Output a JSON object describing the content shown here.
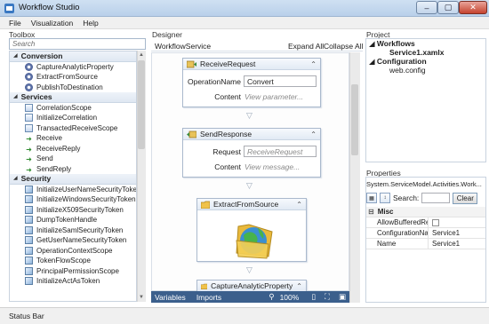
{
  "window": {
    "title": "Workflow Studio",
    "controls": {
      "minimize": "–",
      "maximize": "▢",
      "close": "✕"
    }
  },
  "menu": [
    "File",
    "Visualization",
    "Help"
  ],
  "toolbox": {
    "title": "Toolbox",
    "search_placeholder": "Search",
    "categories": [
      {
        "name": "Conversion",
        "items": [
          "CaptureAnalyticProperty",
          "ExtractFromSource",
          "PublishToDestination"
        ]
      },
      {
        "name": "Services",
        "items": [
          "CorrelationScope",
          "InitializeCorrelation",
          "TransactedReceiveScope",
          "Receive",
          "ReceiveReply",
          "Send",
          "SendReply"
        ]
      },
      {
        "name": "Security",
        "items": [
          "InitializeUserNameSecurityToken",
          "InitializeWindowsSecurityToken",
          "InitializeX509SecurityToken",
          "DumpTokenHandle",
          "InitializeSamlSecurityToken",
          "GetUserNameSecurityToken",
          "OperationContextScope",
          "TokenFlowScope",
          "PrincipalPermissionScope",
          "InitializeActAsToken"
        ]
      }
    ]
  },
  "designer": {
    "title": "Designer",
    "workflow_name": "WorkflowService",
    "expand_all": "Expand All",
    "collapse_all": "Collapse All",
    "activities": {
      "receive": {
        "title": "ReceiveRequest",
        "op_label": "OperationName",
        "op_value": "Convert",
        "content_label": "Content",
        "content_placeholder": "View parameter..."
      },
      "send": {
        "title": "SendResponse",
        "request_label": "Request",
        "request_placeholder": "ReceiveRequest",
        "content_label": "Content",
        "content_placeholder": "View message..."
      },
      "extract": {
        "title": "ExtractFromSource"
      },
      "capture": {
        "title": "CaptureAnalyticProperty"
      }
    },
    "bottombar": {
      "variables": "Variables",
      "imports": "Imports",
      "zoom": "100%"
    }
  },
  "project": {
    "title": "Project",
    "tree": [
      {
        "label": "Workflows",
        "bold": true,
        "children": [
          "Service1.xamlx"
        ]
      },
      {
        "label": "Configuration",
        "bold": true,
        "children": [
          "web.config"
        ]
      }
    ]
  },
  "properties": {
    "title": "Properties",
    "type_name": "System.ServiceModel.Activities.Work...",
    "search_label": "Search:",
    "clear_label": "Clear",
    "category": "Misc",
    "rows": [
      {
        "key": "AllowBufferedRec...",
        "value": ""
      },
      {
        "key": "ConfigurationName",
        "value": "Service1"
      },
      {
        "key": "Name",
        "value": "Service1"
      }
    ]
  },
  "statusbar": {
    "text": "Status Bar"
  },
  "colors": {
    "accent": "#3b5f8c",
    "titlebar": "#c3d7ee"
  }
}
